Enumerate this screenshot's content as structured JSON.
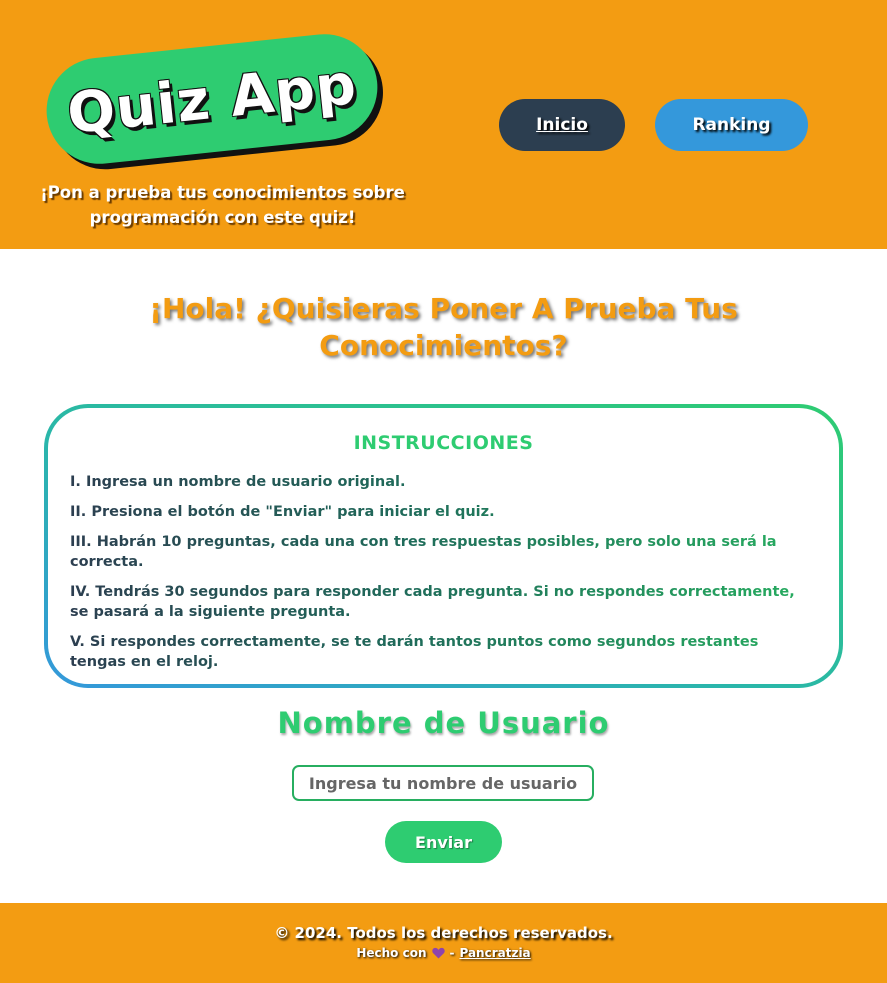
{
  "header": {
    "logo_text": "Quiz App",
    "tagline": "¡Pon a prueba tus conocimientos sobre programación con este quiz!",
    "nav": {
      "inicio": "Inicio",
      "ranking": "Ranking"
    }
  },
  "main": {
    "greeting": "¡Hola! ¿Quisieras Poner A Prueba Tus Conocimientos?",
    "instructions": {
      "title": "INSTRUCCIONES",
      "items": [
        "I. Ingresa un nombre de usuario original.",
        "II. Presiona el botón de \"Enviar\" para iniciar el quiz.",
        "III. Habrán 10 preguntas, cada una con tres respuestas posibles, pero solo una será la correcta.",
        "IV. Tendrás 30 segundos para responder cada pregunta. Si no respondes correctamente, se pasará a la siguiente pregunta.",
        "V. Si respondes correctamente, se te darán tantos puntos como segundos restantes tengas en el reloj."
      ]
    },
    "username": {
      "title": "Nombre de Usuario",
      "placeholder": "Ingresa tu nombre de usuario",
      "value": "",
      "submit_label": "Enviar"
    }
  },
  "footer": {
    "copyright": "© 2024. Todos los derechos reservados.",
    "made_with": "Hecho con",
    "separator": "-",
    "author": "Pancratzia",
    "heart_icon": "purple-heart-icon",
    "heart_color": "#8e44ad"
  },
  "colors": {
    "primary_orange": "#f39c12",
    "accent_green": "#2ecc71",
    "accent_blue": "#3498db",
    "dark_navy": "#2c3e50"
  }
}
